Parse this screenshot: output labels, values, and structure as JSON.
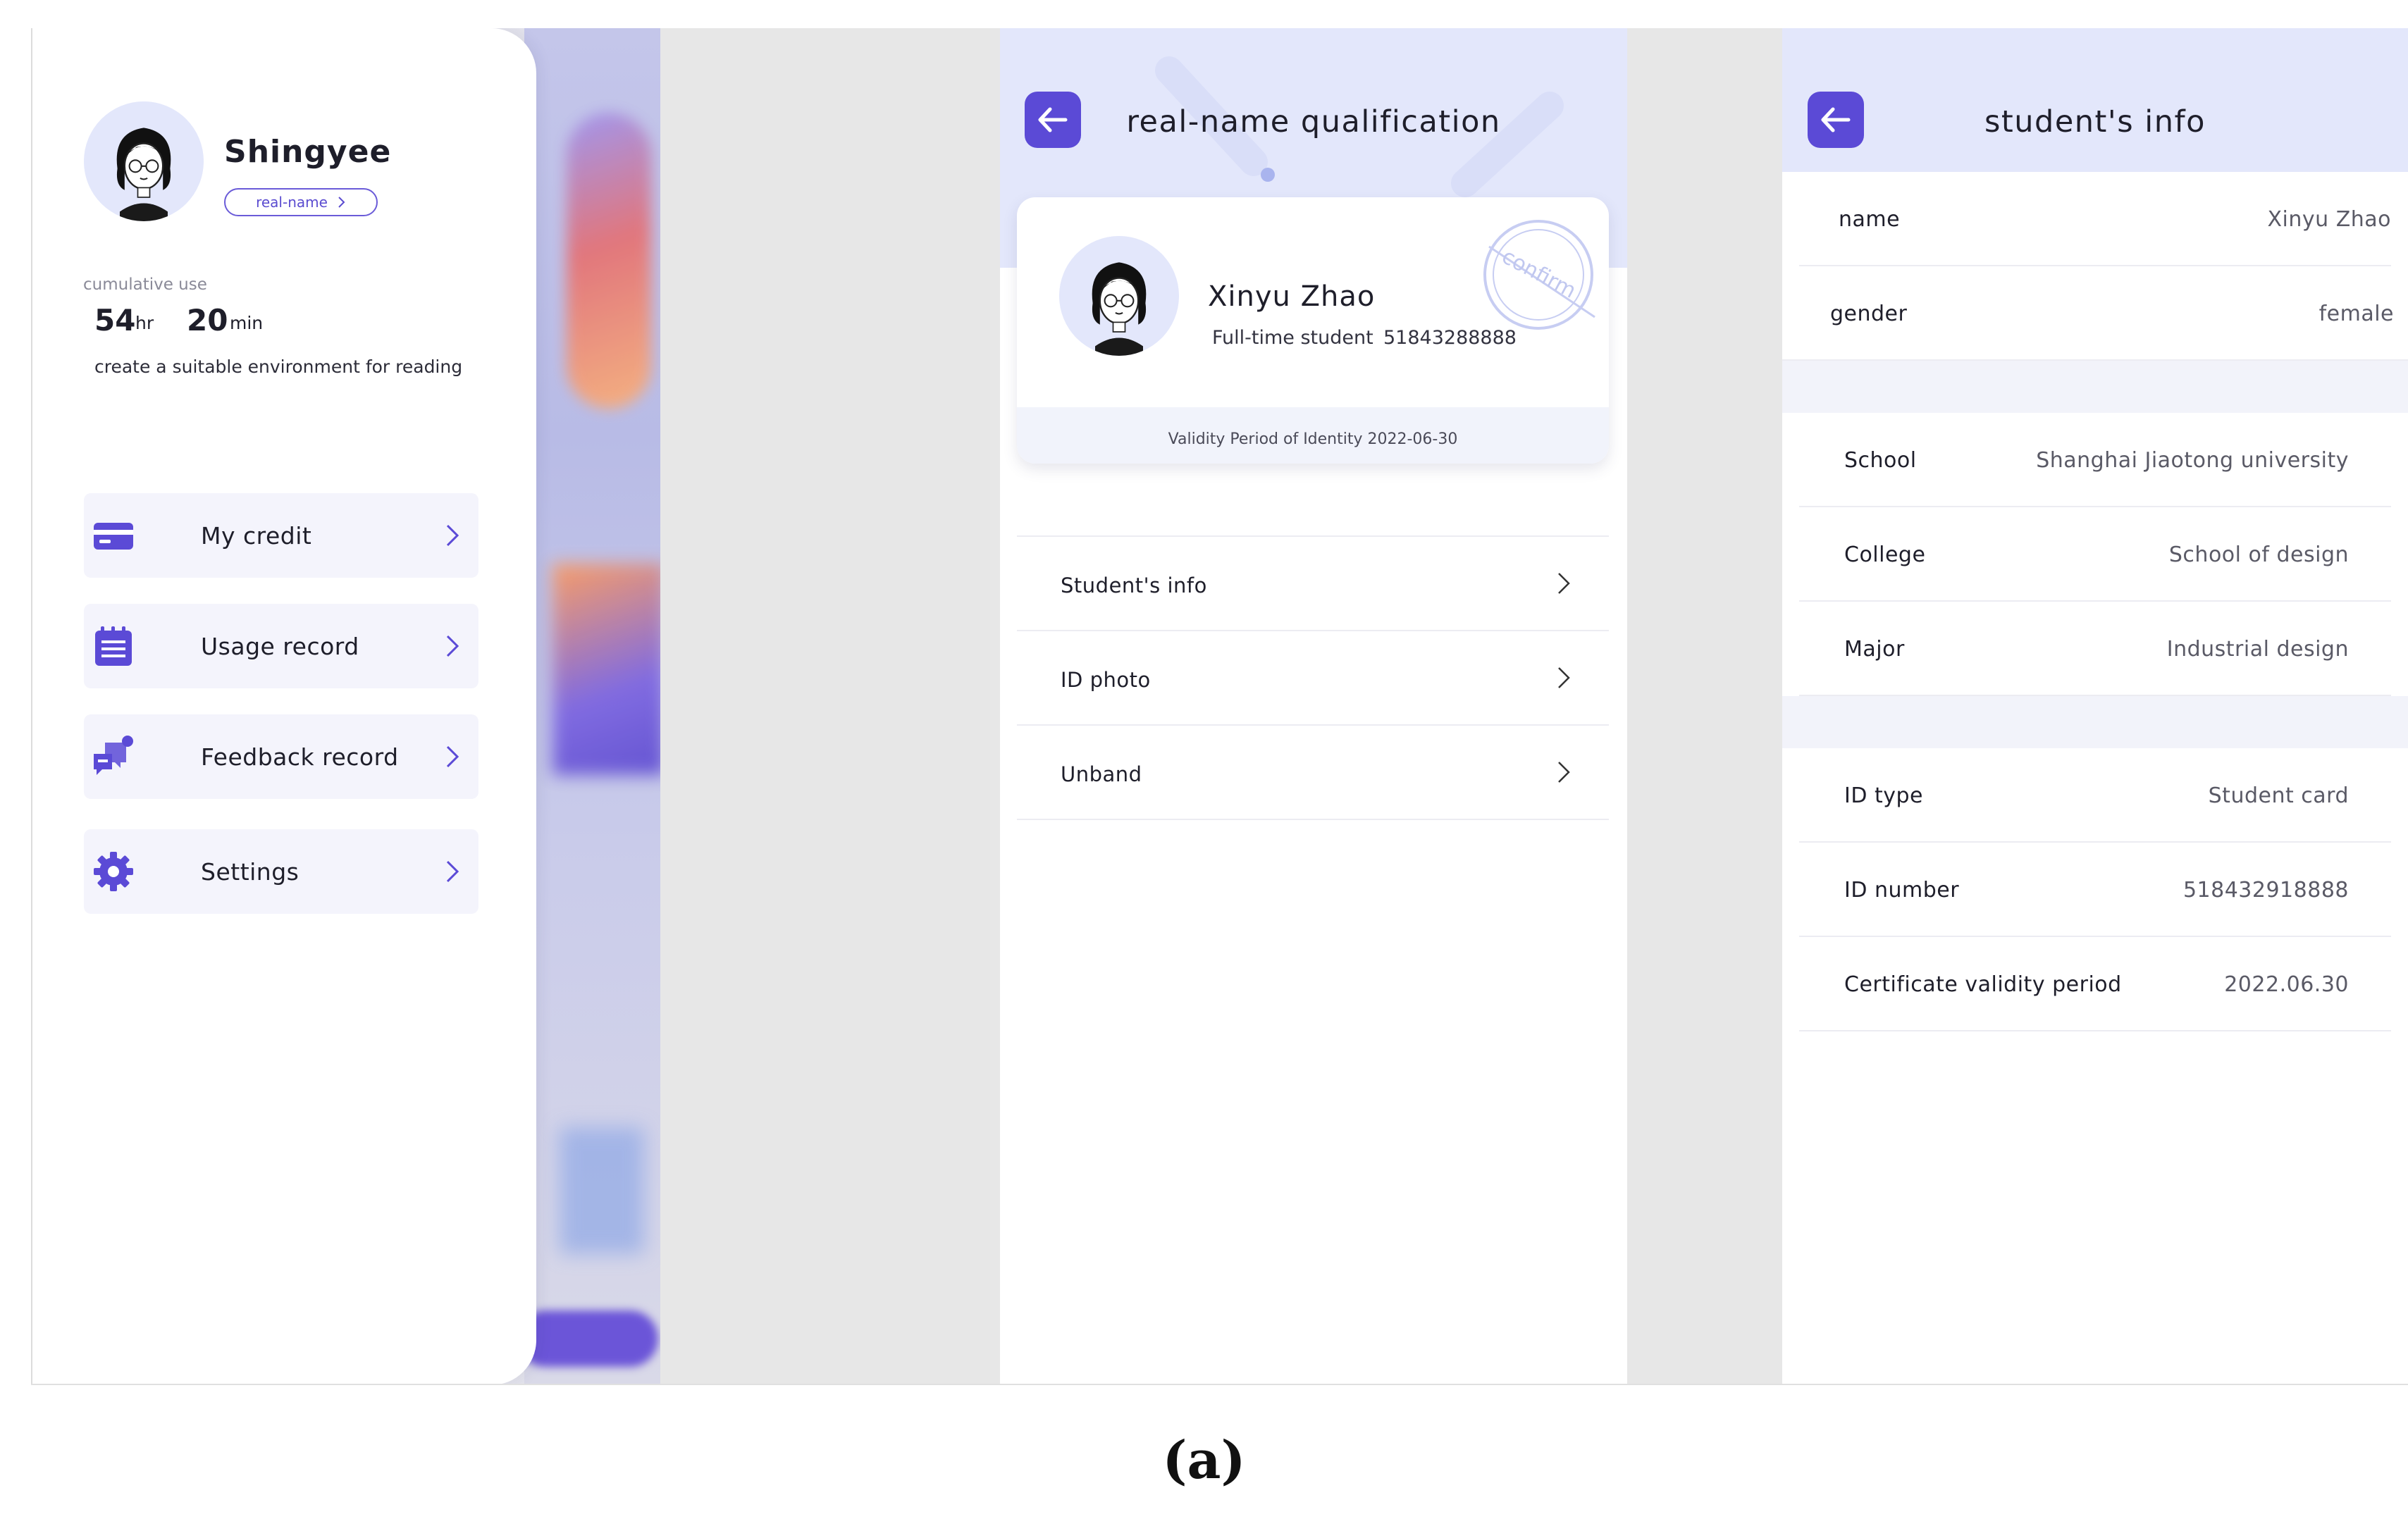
{
  "drawer": {
    "user_name": "Shingyee",
    "real_name_chip": "real-name",
    "cumulative_label": "cumulative use",
    "hours_value": "54",
    "hours_unit": "hr",
    "minutes_value": "20",
    "minutes_unit": "min",
    "tagline": "create a suitable environment for reading",
    "menu": [
      {
        "label": "My credit",
        "icon": "credit-card-icon"
      },
      {
        "label": "Usage record",
        "icon": "calendar-list-icon"
      },
      {
        "label": "Feedback record",
        "icon": "feedback-chat-icon"
      },
      {
        "label": "Settings",
        "icon": "gear-icon"
      }
    ]
  },
  "qualification": {
    "title": "real-name qualification",
    "card": {
      "name": "Xinyu Zhao",
      "student_type": "Full-time student",
      "id": "51843288888",
      "validity": "Validity Period of Identity 2022-06-30",
      "stamp_text": "confirm"
    },
    "rows": [
      {
        "label": "Student's info"
      },
      {
        "label": "ID photo"
      },
      {
        "label": "Unband"
      }
    ]
  },
  "student_info": {
    "title": "student's info",
    "group1": [
      {
        "key": "name",
        "value": "Xinyu Zhao"
      },
      {
        "key": "gender",
        "value": "female"
      }
    ],
    "group2": [
      {
        "key": "School",
        "value": "Shanghai Jiaotong university"
      },
      {
        "key": "College",
        "value": "School of design"
      },
      {
        "key": "Major",
        "value": "Industrial design"
      }
    ],
    "group3": [
      {
        "key": "ID type",
        "value": "Student card"
      },
      {
        "key": "ID number",
        "value": "518432918888"
      },
      {
        "key": "Certificate validity period",
        "value": "2022.06.30"
      }
    ]
  },
  "caption": "(a)",
  "colors": {
    "accent": "#5b4ad6",
    "header_tint": "#e3e7fb",
    "menu_bg": "#f4f4fc"
  }
}
